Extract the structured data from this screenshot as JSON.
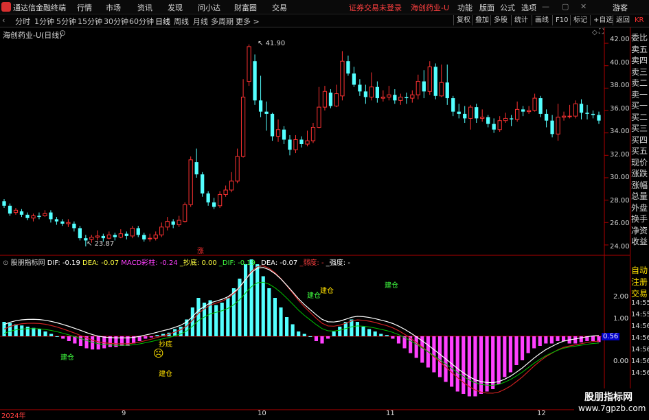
{
  "app": {
    "title": "通达信金融终端",
    "menus": [
      "行情",
      "市场",
      "资讯",
      "发现",
      "问小达",
      "财富圈",
      "交易"
    ],
    "status": "证券交易未登录",
    "stock_title": "海创药业-U",
    "right_menus": [
      "功能",
      "版面",
      "公式",
      "选项"
    ],
    "guest": "游客"
  },
  "periods": [
    "分时",
    "1分钟",
    "5分钟",
    "15分钟",
    "30分钟",
    "60分钟",
    "日线",
    "周线",
    "月线",
    "多周期",
    "更多 >"
  ],
  "active_period": "日线",
  "toolbar_right": [
    "复权",
    "叠加",
    "多股",
    "统计",
    "画线",
    "F10",
    "标记",
    "+自选",
    "返回"
  ],
  "chart_title": "海创药业-U(日线)",
  "price_labels": {
    "high": "41.90",
    "low": "23.87",
    "zhang": "涨"
  },
  "indicator": {
    "name": "股朋指标网",
    "dif": "DIF: -0.19",
    "dea": "DEA: -0.07",
    "macd": "MACD彩柱: -0.24",
    "chaodi": "_抄底: 0.00",
    "dif2": "_DIF: -0.19",
    "dea2": "_DEA: -0.07",
    "ruodu": "_弱度: -",
    "qiangdu": "_强度: -"
  },
  "signals": {
    "chaodi": "抄底",
    "jiancang": "建仓"
  },
  "price_axis": [
    "42.00",
    "40.00",
    "38.00",
    "36.00",
    "34.00",
    "32.00",
    "30.00",
    "28.00",
    "26.00",
    "24.00"
  ],
  "macd_axis": [
    "2.00",
    "1.00",
    "0.00"
  ],
  "macd_badge": "0.56",
  "date_labels": [
    "2024年",
    "9",
    "10",
    "11",
    "12"
  ],
  "right_panel": [
    "委比",
    "卖五",
    "卖四",
    "卖三",
    "卖二",
    "卖一",
    "买一",
    "买二",
    "买三",
    "买四",
    "买五",
    "现价",
    "涨跌",
    "涨幅",
    "总量",
    "外盘",
    "换手",
    "净资",
    "收益"
  ],
  "right_panel2": [
    "自动",
    "注册",
    "交易",
    "14:55",
    "14:55",
    "14:56",
    "14:56",
    "14:56",
    "14:56",
    "14:56"
  ],
  "watermark": {
    "line1": "股朋指标网",
    "line2": "www.7gpzb.com"
  },
  "colors": {
    "up": "#ff3232",
    "down": "#54ffff",
    "macd_down": "#ff40ff",
    "dif": "#ffffff",
    "dea": "#cc2020",
    "signal": "#00c000"
  },
  "chart_data": [
    {
      "type": "candlestick",
      "title": "海创药业-U(日线)",
      "ylim": [
        23.2,
        42.8
      ],
      "candles": [
        [
          27.9,
          27.5,
          28.1,
          27.3
        ],
        [
          27.5,
          26.8,
          27.7,
          26.6
        ],
        [
          26.9,
          27.1,
          27.3,
          26.7
        ],
        [
          27.0,
          26.7,
          27.2,
          26.5
        ],
        [
          26.7,
          26.4,
          26.9,
          26.2
        ],
        [
          26.4,
          26.6,
          26.8,
          26.1
        ],
        [
          26.6,
          26.5,
          26.9,
          26.3
        ],
        [
          26.6,
          26.8,
          27.1,
          26.5
        ],
        [
          26.9,
          26.3,
          27.1,
          26.0
        ],
        [
          26.3,
          26.1,
          26.5,
          25.8
        ],
        [
          26.1,
          25.9,
          26.3,
          25.7
        ],
        [
          25.9,
          26.0,
          26.3,
          25.6
        ],
        [
          25.9,
          25.5,
          26.1,
          25.2
        ],
        [
          25.5,
          24.6,
          25.7,
          24.4
        ],
        [
          24.6,
          24.4,
          24.9,
          23.87
        ],
        [
          24.5,
          24.7,
          24.9,
          24.2
        ],
        [
          24.7,
          24.8,
          25.3,
          24.4
        ],
        [
          24.8,
          24.6,
          25.0,
          24.3
        ],
        [
          24.6,
          24.9,
          25.2,
          24.5
        ],
        [
          24.9,
          24.7,
          25.1,
          24.4
        ],
        [
          24.7,
          25.0,
          25.4,
          24.6
        ],
        [
          25.0,
          24.8,
          25.2,
          24.5
        ],
        [
          24.8,
          25.5,
          25.7,
          24.6
        ],
        [
          25.5,
          24.9,
          25.7,
          24.7
        ],
        [
          24.9,
          24.5,
          25.1,
          24.3
        ],
        [
          24.6,
          24.6,
          25.0,
          24.3
        ],
        [
          24.6,
          24.9,
          25.2,
          24.4
        ],
        [
          24.9,
          25.6,
          26.0,
          24.7
        ],
        [
          25.6,
          26.1,
          26.5,
          25.3
        ],
        [
          26.1,
          25.8,
          26.3,
          25.5
        ],
        [
          25.8,
          26.2,
          26.6,
          25.6
        ],
        [
          26.1,
          27.6,
          27.8,
          26.0
        ],
        [
          27.6,
          31.6,
          31.9,
          27.4
        ],
        [
          31.4,
          30.3,
          32.6,
          30.0
        ],
        [
          30.3,
          28.6,
          30.5,
          28.3
        ],
        [
          28.6,
          27.8,
          28.8,
          27.5
        ],
        [
          27.8,
          27.4,
          28.2,
          27.2
        ],
        [
          27.5,
          28.5,
          28.8,
          27.3
        ],
        [
          28.5,
          28.9,
          29.3,
          28.3
        ],
        [
          28.9,
          29.7,
          30.5,
          28.7
        ],
        [
          29.7,
          31.9,
          32.6,
          29.5
        ],
        [
          31.9,
          37.2,
          38.8,
          31.8
        ],
        [
          38.6,
          41.7,
          41.9,
          38.2
        ],
        [
          40.4,
          36.9,
          41.0,
          36.5
        ],
        [
          36.9,
          35.9,
          39.1,
          35.4
        ],
        [
          35.9,
          35.7,
          36.8,
          34.2
        ],
        [
          35.7,
          33.7,
          35.8,
          33.3
        ],
        [
          33.7,
          34.3,
          35.2,
          33.2
        ],
        [
          34.3,
          33.4,
          34.6,
          33.0
        ],
        [
          33.4,
          32.5,
          33.8,
          32.0
        ],
        [
          32.5,
          33.4,
          33.8,
          32.2
        ],
        [
          33.4,
          33.0,
          33.7,
          32.7
        ],
        [
          33.0,
          33.3,
          34.2,
          32.8
        ],
        [
          33.3,
          34.5,
          34.9,
          33.1
        ],
        [
          34.5,
          36.3,
          38.1,
          34.4
        ],
        [
          36.3,
          37.7,
          38.2,
          36.0
        ],
        [
          37.6,
          36.4,
          37.9,
          36.2
        ],
        [
          36.4,
          37.5,
          38.3,
          36.3
        ],
        [
          37.3,
          40.4,
          41.3,
          36.9
        ],
        [
          40.4,
          39.3,
          40.9,
          39.1
        ],
        [
          39.3,
          38.3,
          39.9,
          38.1
        ],
        [
          38.3,
          37.7,
          38.8,
          37.3
        ],
        [
          37.7,
          37.2,
          38.3,
          36.6
        ],
        [
          37.2,
          38.1,
          39.4,
          36.9
        ],
        [
          38.1,
          37.1,
          38.6,
          36.7
        ],
        [
          37.1,
          37.2,
          37.8,
          36.8
        ],
        [
          37.2,
          37.4,
          38.2,
          36.9
        ],
        [
          37.4,
          36.9,
          37.9,
          36.6
        ],
        [
          36.9,
          37.2,
          37.5,
          36.5
        ],
        [
          37.2,
          37.1,
          37.6,
          36.6
        ],
        [
          37.1,
          37.4,
          37.8,
          36.7
        ],
        [
          37.4,
          38.6,
          39.2,
          37.0
        ],
        [
          38.6,
          37.7,
          39.6,
          37.1
        ],
        [
          37.7,
          39.9,
          40.4,
          37.4
        ],
        [
          39.9,
          37.3,
          40.2,
          37.0
        ],
        [
          37.3,
          38.5,
          40.1,
          37.2
        ],
        [
          38.5,
          37.1,
          40.1,
          36.5
        ],
        [
          37.1,
          35.9,
          37.3,
          35.5
        ],
        [
          35.9,
          35.7,
          36.6,
          35.3
        ],
        [
          35.7,
          35.3,
          36.4,
          34.9
        ],
        [
          35.3,
          36.3,
          36.5,
          34.3
        ],
        [
          36.3,
          35.3,
          36.6,
          34.9
        ],
        [
          35.3,
          35.4,
          36.1,
          35.0
        ],
        [
          35.4,
          34.8,
          35.6,
          34.5
        ],
        [
          34.8,
          34.3,
          35.3,
          34.0
        ],
        [
          34.3,
          35.1,
          35.5,
          34.1
        ],
        [
          35.1,
          35.3,
          35.8,
          34.9
        ],
        [
          35.3,
          35.2,
          35.6,
          34.6
        ],
        [
          35.2,
          36.1,
          36.8,
          35.0
        ],
        [
          36.1,
          35.9,
          36.4,
          35.5
        ],
        [
          35.9,
          36.0,
          36.4,
          35.7
        ],
        [
          36.0,
          37.1,
          37.5,
          35.9
        ],
        [
          37.1,
          35.7,
          37.3,
          35.4
        ],
        [
          35.7,
          35.1,
          36.1,
          34.5
        ],
        [
          35.1,
          33.9,
          35.6,
          33.6
        ],
        [
          33.9,
          35.4,
          36.6,
          33.3
        ],
        [
          35.4,
          35.5,
          35.9,
          35.1
        ],
        [
          35.5,
          35.5,
          36.5,
          35.3
        ],
        [
          35.5,
          36.6,
          36.9,
          35.3
        ],
        [
          36.6,
          35.8,
          37.0,
          35.2
        ],
        [
          35.8,
          35.7,
          36.5,
          35.2
        ],
        [
          35.7,
          35.6,
          36.0,
          35.3
        ],
        [
          35.6,
          35.1,
          35.9,
          34.8
        ]
      ]
    },
    {
      "type": "bar",
      "title": "股朋指标网",
      "ylim": [
        -3.0,
        3.0
      ],
      "values": [
        0.6,
        0.55,
        0.5,
        0.45,
        0.4,
        0.35,
        0.3,
        0.2,
        0.1,
        0.0,
        -0.1,
        -0.2,
        -0.3,
        -0.4,
        -0.5,
        -0.55,
        -0.55,
        -0.5,
        -0.45,
        -0.45,
        -0.4,
        -0.4,
        -0.3,
        -0.2,
        -0.1,
        -0.05,
        0.05,
        0.1,
        0.15,
        0.3,
        0.4,
        0.7,
        1.2,
        1.6,
        1.4,
        1.5,
        1.3,
        1.4,
        1.6,
        2.0,
        2.4,
        3.0,
        3.2,
        3.0,
        2.5,
        2.0,
        1.6,
        1.2,
        0.8,
        0.5,
        0.2,
        0.1,
        0.0,
        -0.2,
        -0.3,
        -0.1,
        0.2,
        0.4,
        0.6,
        0.7,
        0.6,
        0.4,
        0.3,
        0.2,
        0.1,
        0.05,
        -0.1,
        -0.3,
        -0.5,
        -0.7,
        -0.9,
        -1.1,
        -1.3,
        -1.5,
        -1.7,
        -1.9,
        -2.1,
        -2.3,
        -2.4,
        -2.5,
        -2.5,
        -2.4,
        -2.3,
        -2.2,
        -2.0,
        -1.7,
        -1.5,
        -1.2,
        -1.0,
        -0.7,
        -0.5,
        -0.4,
        -0.3,
        -0.3,
        -0.2,
        -0.2,
        -0.3,
        -0.3,
        -0.25,
        -0.2,
        -0.2,
        -0.24
      ]
    }
  ]
}
